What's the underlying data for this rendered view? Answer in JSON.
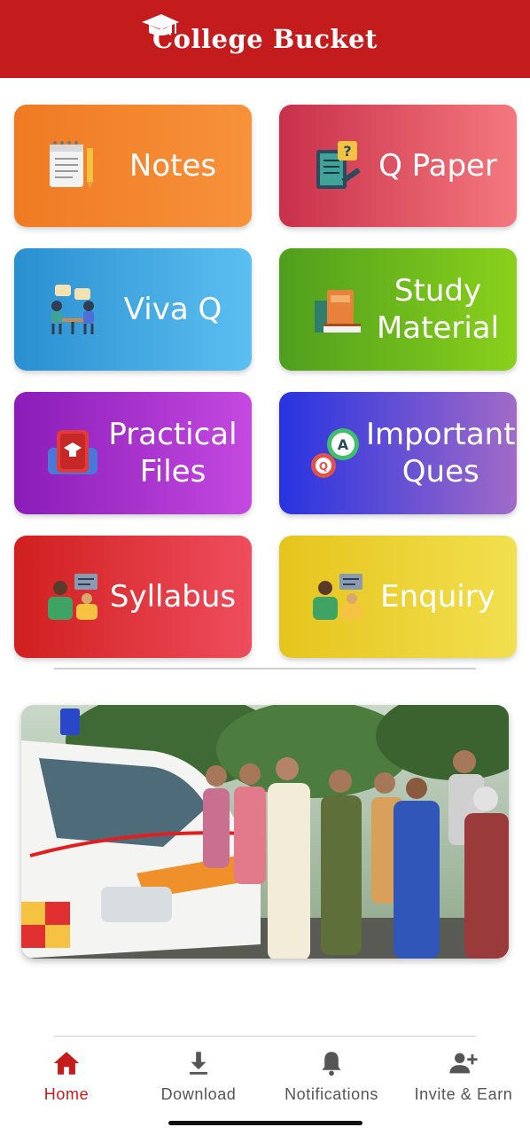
{
  "header": {
    "title": "College Bucket",
    "logo_icon": "graduation-cap-icon"
  },
  "colors": {
    "brand": "#c41c1c"
  },
  "tiles": [
    {
      "label": "Notes",
      "icon": "notepad-icon"
    },
    {
      "label": "Q Paper",
      "icon": "question-paper-icon"
    },
    {
      "label": "Viva Q",
      "icon": "interview-icon"
    },
    {
      "label_line1": "Study",
      "label_line2": "Material",
      "icon": "books-icon"
    },
    {
      "label_line1": "Practical",
      "label_line2": "Files",
      "icon": "practical-file-icon"
    },
    {
      "label_line1": "Important",
      "label_line2": "Ques",
      "icon": "qa-chat-icon"
    },
    {
      "label": "Syllabus",
      "icon": "teacher-board-icon"
    },
    {
      "label": "Enquiry",
      "icon": "teacher-board-icon"
    }
  ],
  "banner": {
    "image": "ambulance-inauguration-photo"
  },
  "bottom_nav": [
    {
      "label": "Home",
      "icon": "home-icon",
      "active": true
    },
    {
      "label": "Download",
      "icon": "download-icon",
      "active": false
    },
    {
      "label": "Notifications",
      "icon": "bell-icon",
      "active": false
    },
    {
      "label": "Invite & Earn",
      "icon": "add-person-icon",
      "active": false
    }
  ]
}
